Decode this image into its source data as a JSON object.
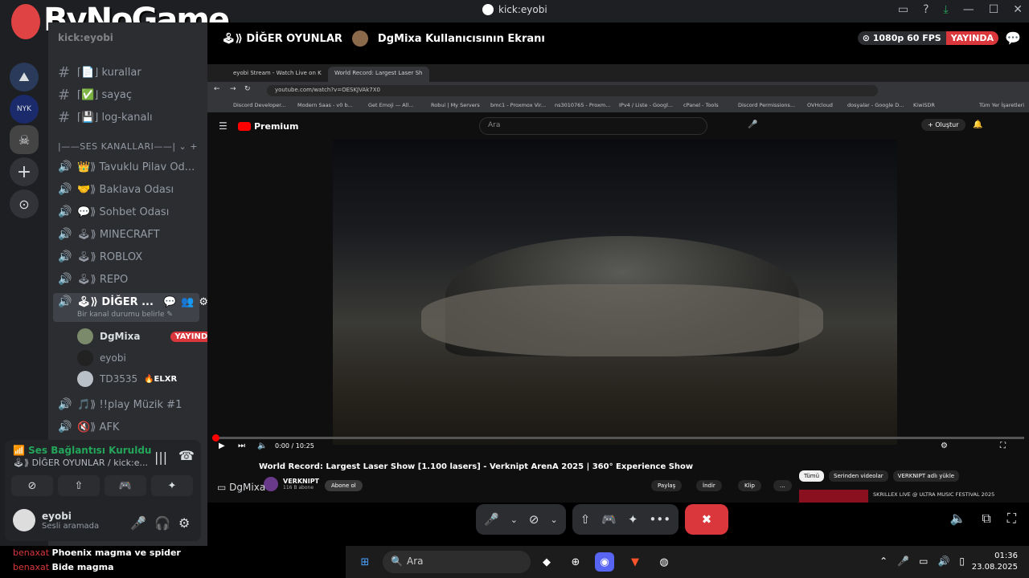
{
  "window": {
    "title": "kick:eyobi",
    "controls": [
      "▭",
      "?",
      "⤓",
      "—",
      "☐",
      "✕"
    ]
  },
  "watermark": "ByNoGame",
  "server_name": "kick:eyobi",
  "guilds": [
    {
      "icon": "⛰"
    },
    {
      "icon": "NYK"
    },
    {
      "icon": "☠"
    },
    {
      "icon": "+"
    },
    {
      "icon": "⊙"
    }
  ],
  "text_channels": [
    {
      "label": "⌈📄⌋ kurallar"
    },
    {
      "label": "⌈✅⌋ sayaç"
    },
    {
      "label": "⌈💾⌋ log-kanalı"
    }
  ],
  "voice_category": "|——SES KANALLARI——|",
  "voice_channels": [
    {
      "label": "👑⟫ Tavuklu Pilav Od..."
    },
    {
      "label": "🤝⟫ Baklava Odası"
    },
    {
      "label": "💬⟫ Sohbet Odası"
    },
    {
      "label": "🕹⟫ MINECRAFT"
    },
    {
      "label": "🕹⟫ ROBLOX"
    },
    {
      "label": "🕹⟫ REPO"
    },
    {
      "label": "🕹⟫ DİĞER ..."
    },
    {
      "label": "🎵⟫ !!play Müzik #1"
    },
    {
      "label": "🔇⟫ AFK"
    }
  ],
  "active_channel_status": "Bir kanal durumu belirle ✎",
  "channel_users": [
    {
      "name": "DgMixa",
      "badge": "YAYINDA"
    },
    {
      "name": "eyobi",
      "badge": ""
    },
    {
      "name": "TD3535",
      "badge": "🔥ELXR"
    }
  ],
  "voice_panel": {
    "status": "Ses Bağlantısı Kuruldu",
    "channel": "🕹⟫ DİĞER OYUNLAR / kick:e...",
    "username": "eyobi",
    "user_status": "Sesli aramada"
  },
  "stream_header": {
    "channel": "🕹⟫ DİĞER OYUNLAR",
    "screen": "DgMixa Kullanıcısının Ekranı",
    "quality": "⊙ 1080p 60 FPS",
    "live": "YAYINDA"
  },
  "browser": {
    "tabs": [
      {
        "label": "eyobi Stream - Watch Live on K"
      },
      {
        "label": "World Record: Largest Laser Sh"
      }
    ],
    "url": "youtube.com/watch?v=OESKJVAk7X0",
    "bookmarks": [
      "Discord Developer...",
      "Modern Saas - v0 b...",
      "Get Emoji — All...",
      "Robui | My Servers",
      "bmc1 - Proxmox Vir...",
      "ns3010765 - Proxm...",
      "IPv4 / Liste - Googl...",
      "cPanel - Tools",
      "Discord Permissions...",
      "OVHcloud",
      "dosyalar - Google D...",
      "KiwiSDR",
      "Tüm Yer İşaretleri"
    ]
  },
  "youtube": {
    "logo": "Premium",
    "search_placeholder": "Ara",
    "create": "+ Oluştur",
    "time": "0:00 / 10:25",
    "video_title": "World Record: Largest Laser Show [1.100 lasers] - Verknipt ArenA 2025 | 360° Experience Show",
    "channel": "VERKNIPT",
    "subs": "116 B abone",
    "subscribe": "Abone ol",
    "actions": [
      "Paylaş",
      "İndir",
      "Klip",
      "..."
    ],
    "chips": [
      "Tümü",
      "Serinden videolar",
      "VERKNIPT adlı yükle"
    ],
    "rec_title": "SKRILLEX LIVE @ ULTRA MUSIC FESTIVAL 2025"
  },
  "stream_owner_tag": "DgMixa",
  "chat": [
    {
      "user": "benaxat",
      "msg": "Phoenix magma ve spider"
    },
    {
      "user": "benaxat",
      "msg": "Bide magma"
    }
  ],
  "taskbar": {
    "search": "Ara",
    "time": "01:36",
    "date": "23.08.2025"
  }
}
